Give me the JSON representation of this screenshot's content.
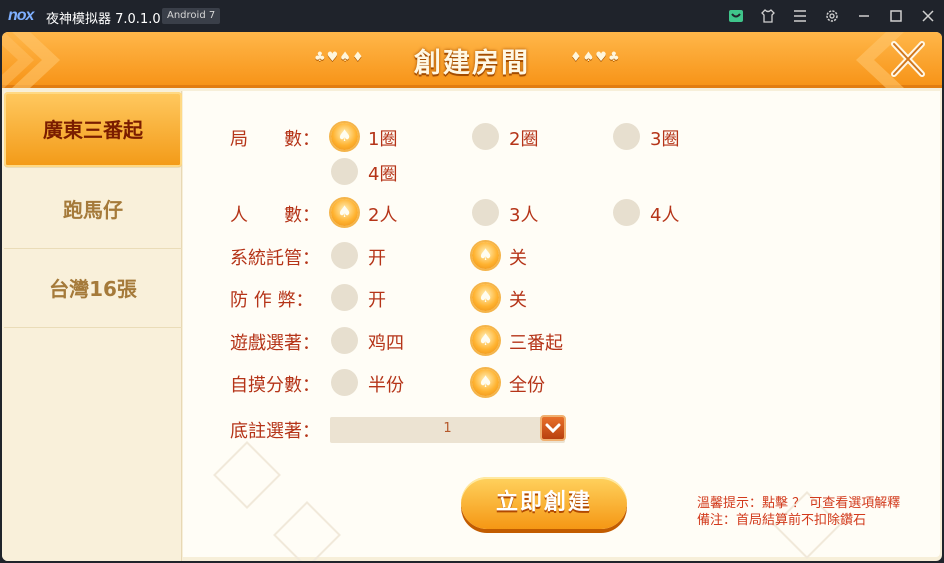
{
  "emulator": {
    "logo": "nox",
    "title": "夜神模拟器 7.0.1.0",
    "android_badge": "Android 7",
    "icons": [
      "shop-icon",
      "shirt-icon",
      "menu-icon",
      "settings-icon",
      "minimize-icon",
      "maximize-icon",
      "close-icon"
    ]
  },
  "dialog": {
    "title": "創建房間",
    "suits_left": "♣♥♠♦",
    "suits_right": "♦♠♥♣"
  },
  "sidebar": {
    "tabs": [
      {
        "label": "廣東三番起",
        "active": true
      },
      {
        "label": "跑馬仔",
        "active": false
      },
      {
        "label": "台灣16張",
        "active": false
      }
    ]
  },
  "form": {
    "rounds": {
      "label": "局　　數：",
      "options": [
        "1圈",
        "2圈",
        "3圈",
        "4圈"
      ],
      "selected": 0
    },
    "players": {
      "label": "人　　數：",
      "options": [
        "2人",
        "3人",
        "4人"
      ],
      "selected": 0
    },
    "auto_host": {
      "label": "系統託管：",
      "options": [
        "开",
        "关"
      ],
      "selected": 1
    },
    "anti_cheat": {
      "label": "防 作 弊：",
      "options": [
        "开",
        "关"
      ],
      "selected": 1
    },
    "game_rule": {
      "label": "遊戲選著：",
      "options": [
        "鸡四",
        "三番起"
      ],
      "selected": 1
    },
    "self_draw": {
      "label": "自摸分數：",
      "options": [
        "半份",
        "全份"
      ],
      "selected": 1
    },
    "base_bet": {
      "label": "底註選著：",
      "value": "1"
    }
  },
  "create_button": "立即創建",
  "tips": {
    "line1": "溫馨提示：點擊 ？ 可查看選項解釋",
    "line2": "備注：首局結算前不扣除鑽石"
  },
  "colors": {
    "accent": "#f59714",
    "label_red": "#b53418",
    "background": "#fffdf6"
  }
}
